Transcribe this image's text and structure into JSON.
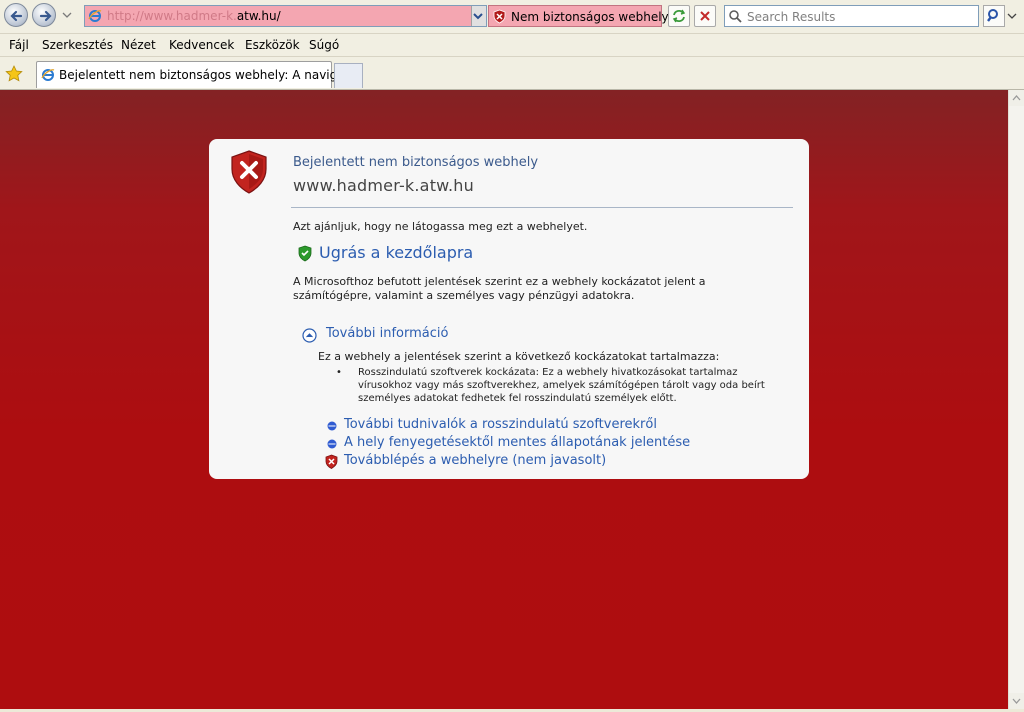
{
  "address": {
    "url_faded": "http://www.hadmer-k.",
    "url_strong": "atw.hu/"
  },
  "security_warning": "Nem biztonságos webhely",
  "search": {
    "placeholder": "Search Results"
  },
  "menu": [
    "Fájl",
    "Szerkesztés",
    "Nézet",
    "Kedvencek",
    "Eszközök",
    "Súgó"
  ],
  "tab": {
    "title": "Bejelentett nem biztonságos webhely: A navig..."
  },
  "panel": {
    "title": "Bejelentett nem biztonságos webhely",
    "site": "www.hadmer-k.atw.hu",
    "recommend": "Azt ajánljuk, hogy ne látogassa meg ezt a webhelyet.",
    "home_link": "Ugrás a kezdőlapra",
    "description": "A Microsofthoz befutott jelentések szerint ez a webhely kockázatot jelent a számítógépre, valamint a személyes vagy pénzügyi adatokra.",
    "more_info": "További információ",
    "risk_intro": "Ez a webhely a jelentések szerint a következő kockázatokat tartalmazza:",
    "risk_item": "Rosszindulatú szoftverek kockázata: Ez a webhely hivatkozásokat tartalmaz vírusokhoz vagy más szoftverekhez, amelyek számítógépen tárolt vagy oda beírt személyes adatokat fedhetek fel rosszindulatú személyek előtt.",
    "links": [
      "További tudnivalók a rosszindulatú szoftverekről",
      "A hely fenyegetésektől mentes állapotának jelentése",
      "Továbblépés a webhelyre (nem javasolt)"
    ]
  },
  "colors": {
    "page_bg_top": "#832224",
    "page_bg_bottom": "#ae0d0f",
    "address_alert": "#f4a6b1",
    "link": "#2c5db0",
    "title": "#3b5a8c"
  },
  "icons": {
    "back": "back-arrow-icon",
    "forward": "forward-arrow-icon",
    "shield": "shield-x-icon",
    "home_shield": "green-shield-icon",
    "more": "collapse-up-icon"
  }
}
